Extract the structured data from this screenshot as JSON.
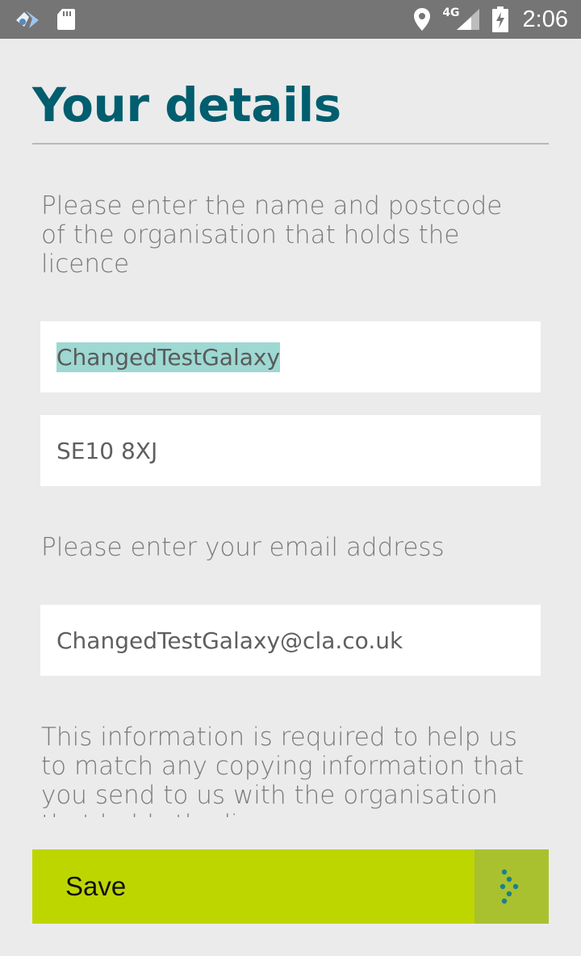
{
  "status_bar": {
    "time": "2:06",
    "network": "4G",
    "icons": [
      "app-icon",
      "sd-card-icon",
      "location-icon",
      "signal-icon",
      "battery-charging-icon"
    ]
  },
  "page": {
    "title": "Your details",
    "intro_text": "Please enter the name and postcode of the organisation that holds the licence",
    "organisation_name": "ChangedTestGalaxy",
    "postcode": "SE10 8XJ",
    "email_label": "Please enter your email address",
    "email": "ChangedTestGalaxy@cla.co.uk",
    "info_text": "This information is required to help us to match any copying information that you send to us with the organisation that holds the licence"
  },
  "actions": {
    "save_label": "Save",
    "save_icon": "dotted-arrow-icon"
  },
  "colors": {
    "title": "#005e6e",
    "accent": "#bed600",
    "status_bar": "#757575",
    "selection": "#9ed8d2"
  }
}
